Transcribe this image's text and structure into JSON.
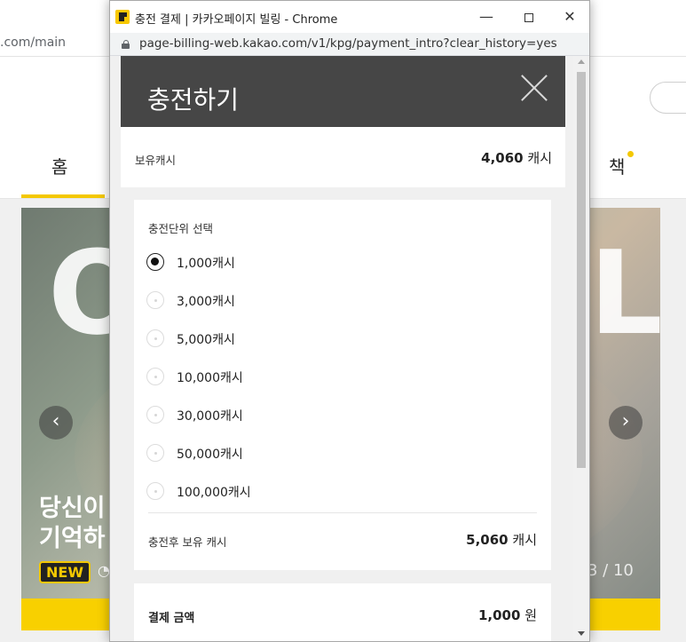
{
  "background": {
    "url": ".com/main",
    "tabs": {
      "home": "홈",
      "book": "책"
    },
    "banner": {
      "big_text_left": "O",
      "big_text_right": "L",
      "title_lines": [
        "당신이",
        "기억하"
      ],
      "badge": "NEW",
      "pager": "3 / 10"
    }
  },
  "window": {
    "title": "충전 결제 | 카카오페이지 빌링 - Chrome",
    "url": "page-billing-web.kakao.com/v1/kpg/payment_intro?clear_history=yes"
  },
  "header": {
    "title": "충전하기"
  },
  "balance": {
    "label": "보유캐시",
    "amount": "4,060",
    "unit": "캐시"
  },
  "charge": {
    "label": "충전단위 선택",
    "options": [
      {
        "label": "1,000캐시",
        "selected": true
      },
      {
        "label": "3,000캐시",
        "selected": false
      },
      {
        "label": "5,000캐시",
        "selected": false
      },
      {
        "label": "10,000캐시",
        "selected": false
      },
      {
        "label": "30,000캐시",
        "selected": false
      },
      {
        "label": "50,000캐시",
        "selected": false
      },
      {
        "label": "100,000캐시",
        "selected": false
      }
    ],
    "after_label": "충전후 보유 캐시",
    "after_amount": "5,060",
    "after_unit": "캐시"
  },
  "payment": {
    "label": "결제 금액",
    "amount": "1,000",
    "unit": "원"
  },
  "colors": {
    "accent": "#f8c800",
    "header_bg": "#464646"
  }
}
